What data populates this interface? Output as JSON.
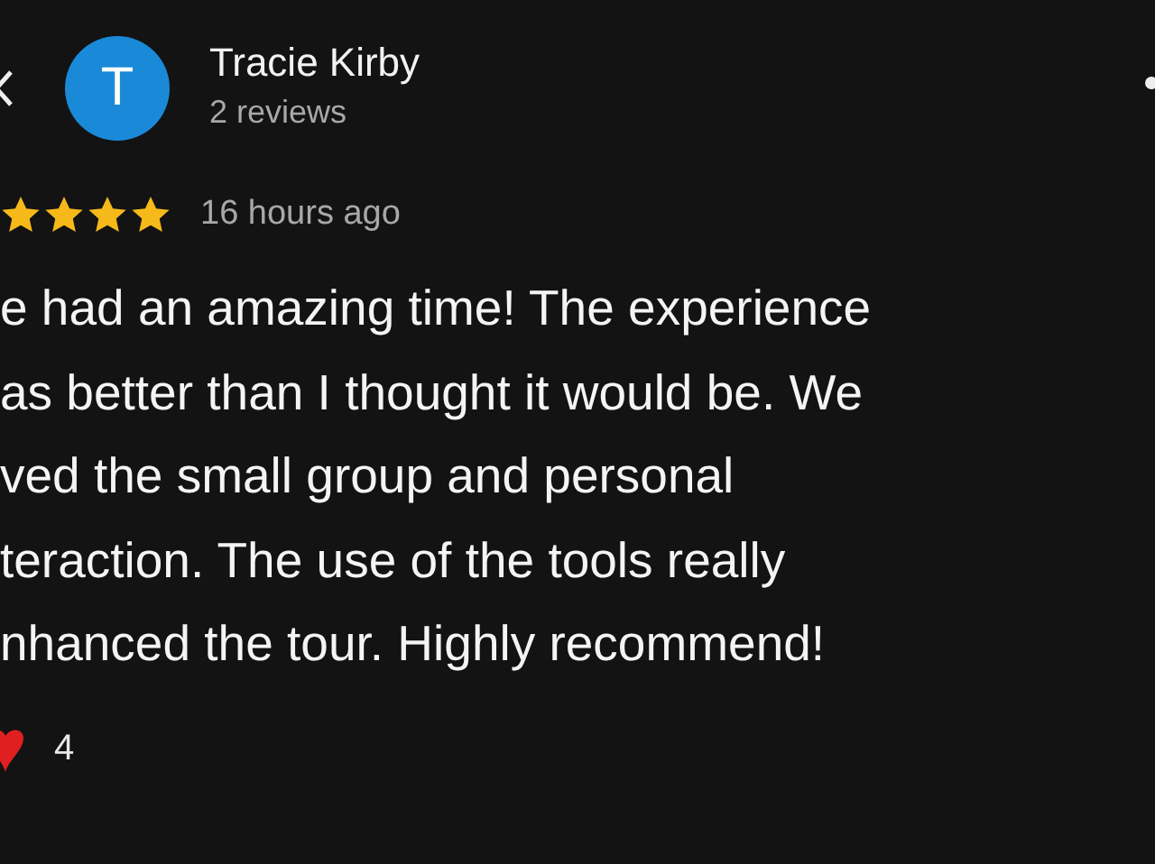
{
  "reviewer": {
    "initial": "T",
    "name": "Tracie Kirby",
    "reviews": "2 reviews"
  },
  "rating": {
    "stars": 4,
    "time": "16 hours ago"
  },
  "review_lines": [
    "e had an amazing time! The experience",
    "as better than I thought it would be. We",
    "ved the small group and personal",
    "teraction. The use of the tools really",
    "nhanced the tour. Highly recommend!"
  ],
  "reactions": {
    "count": "4"
  }
}
